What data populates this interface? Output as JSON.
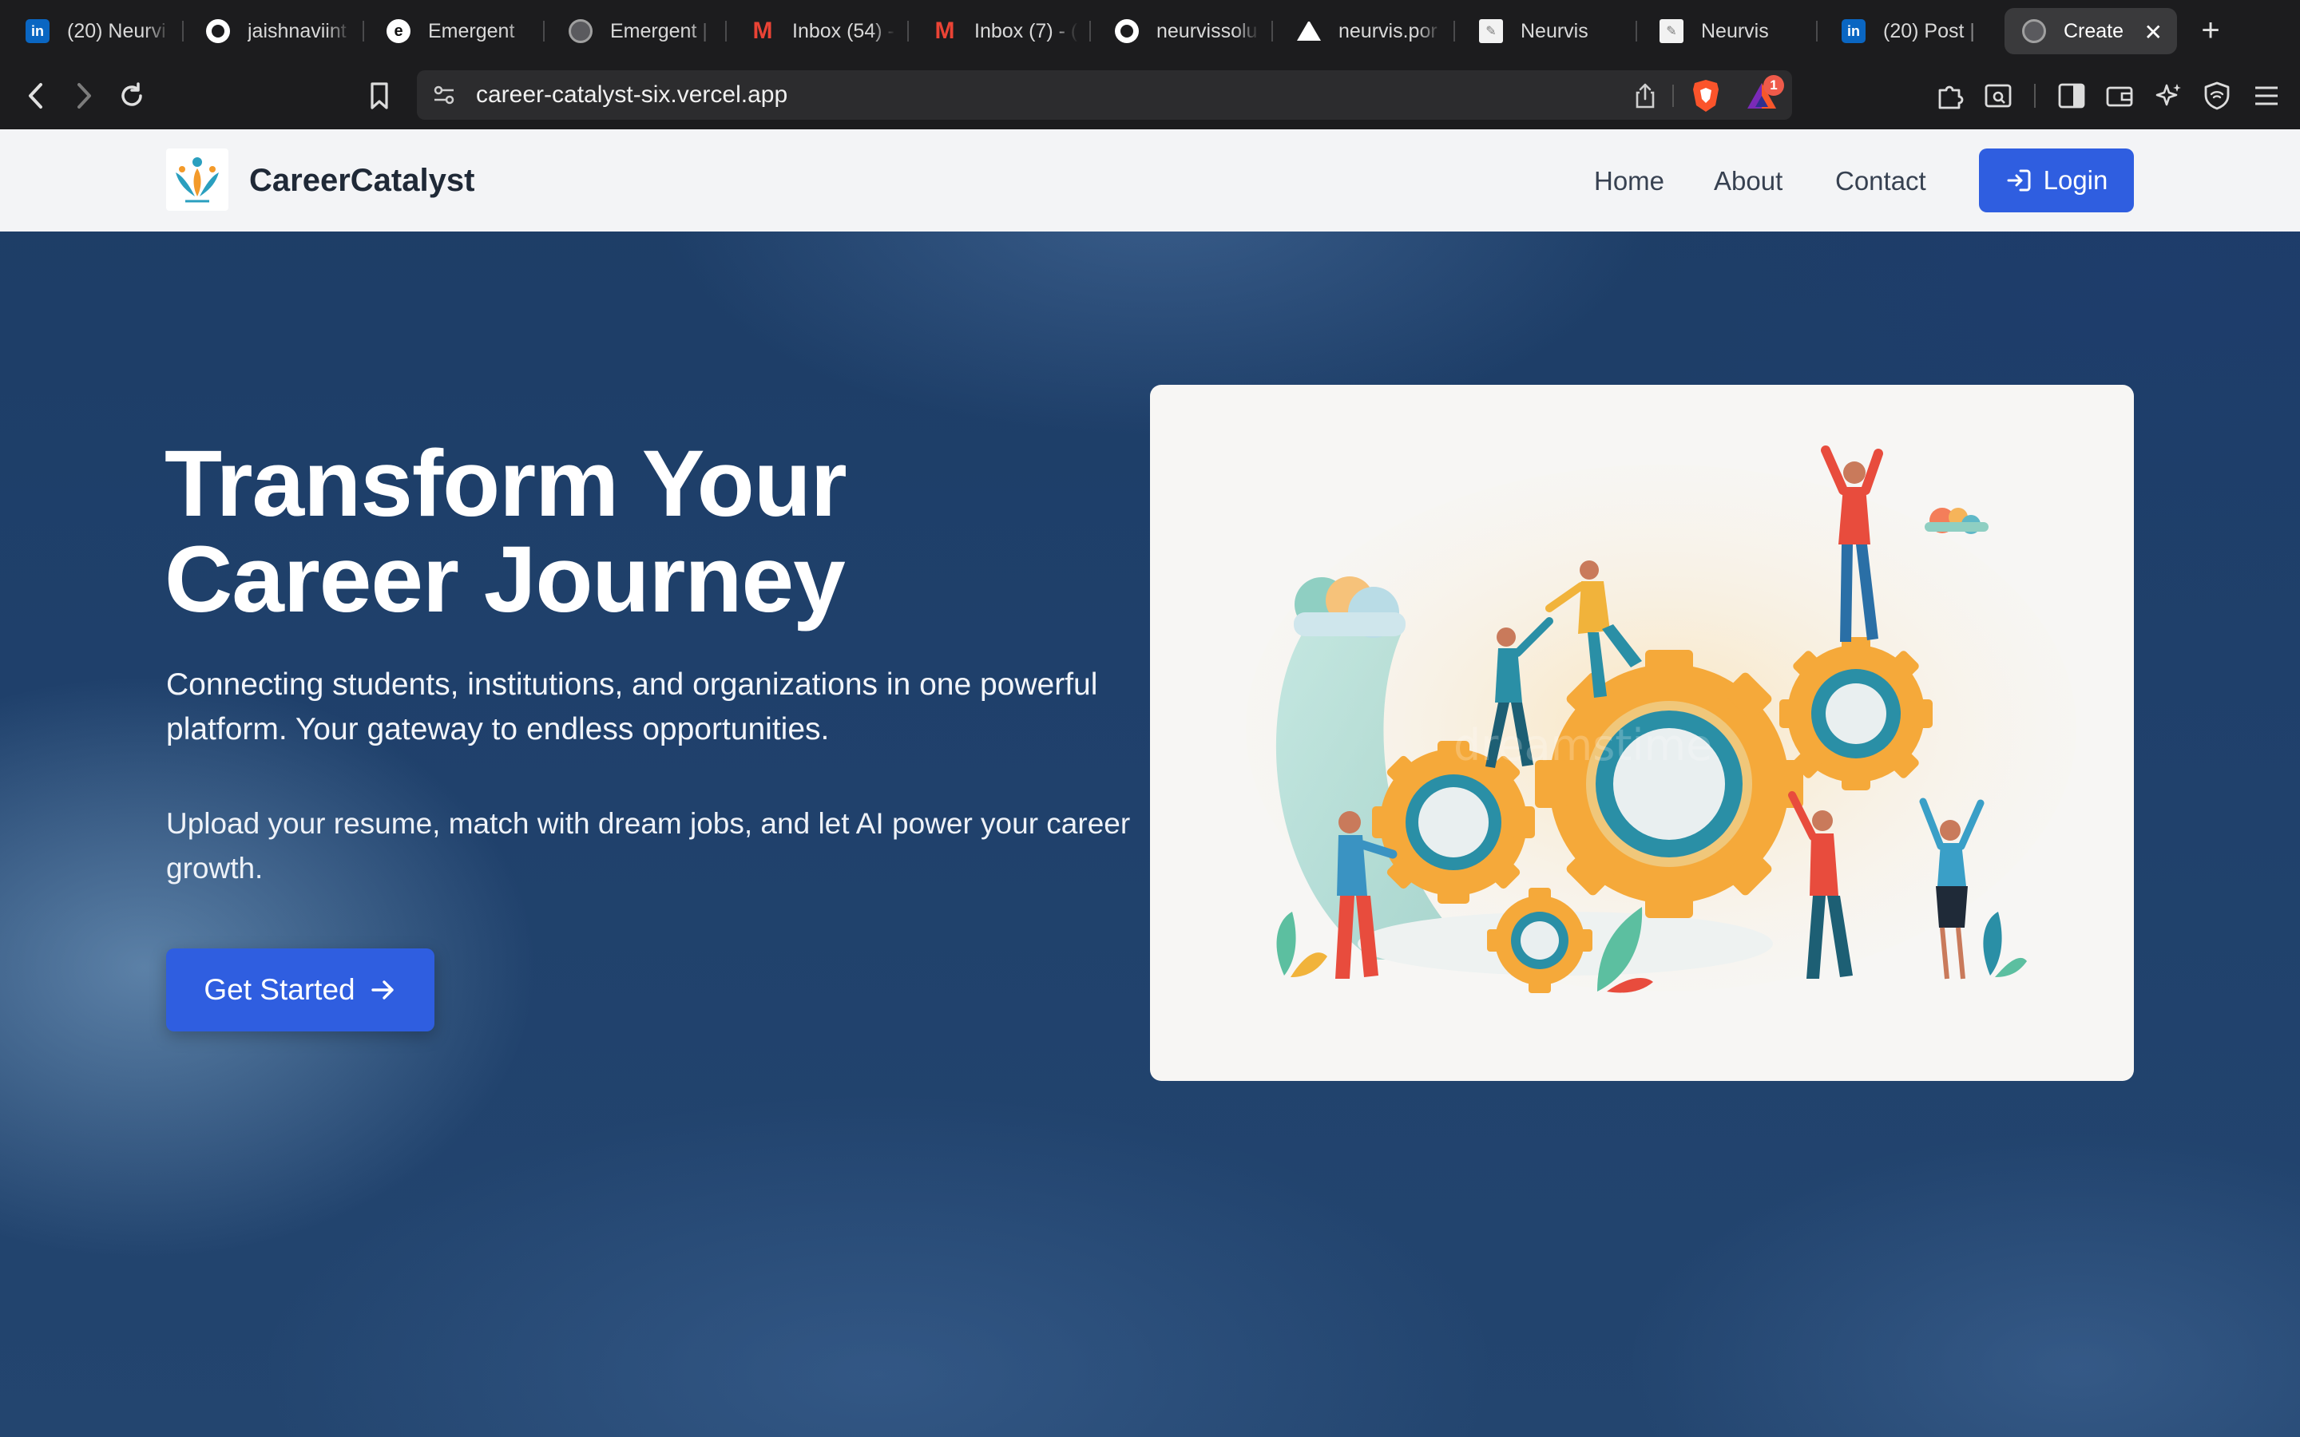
{
  "browser": {
    "tabs": [
      {
        "title": "(20) Neurvi",
        "icon": "linkedin-icon"
      },
      {
        "title": "jaishnaviint",
        "icon": "github-icon"
      },
      {
        "title": "Emergent",
        "icon": "emergent-icon"
      },
      {
        "title": "Emergent |",
        "icon": "globe-icon"
      },
      {
        "title": "Inbox (54) -",
        "icon": "gmail-icon"
      },
      {
        "title": "Inbox (7) - (",
        "icon": "gmail-icon"
      },
      {
        "title": "neurvissolu",
        "icon": "github-icon"
      },
      {
        "title": "neurvis.por",
        "icon": "vercel-icon"
      },
      {
        "title": "Neurvis",
        "icon": "neurvis-icon"
      },
      {
        "title": "Neurvis",
        "icon": "neurvis-icon"
      },
      {
        "title": "(20) Post |",
        "icon": "linkedin-icon"
      },
      {
        "title": "Create",
        "icon": "globe-icon",
        "active": true
      }
    ],
    "close_glyph": "✕",
    "new_tab_glyph": "+",
    "url": "career-catalyst-six.vercel.app",
    "rewards_badge": "1",
    "favicon_text": {
      "linkedin": "in",
      "emergent": "e",
      "gmail": "M"
    }
  },
  "site": {
    "brand": "CareerCatalyst",
    "nav": {
      "home": "Home",
      "about": "About",
      "contact": "Contact",
      "login": "Login"
    },
    "hero": {
      "title_line1": "Transform Your",
      "title_line2": "Career Journey",
      "subtitle": "Connecting students, institutions, and organizations in one powerful platform. Your gateway to endless opportunities.",
      "subtitle2": "Upload your resume, match with dream jobs, and let AI power your career growth.",
      "cta": "Get Started"
    },
    "illustration": {
      "watermark": "dreamstime"
    }
  },
  "colors": {
    "accent": "#2f5ee0",
    "navbar_bg": "#f3f4f6",
    "hero_bg": "#1f406b",
    "browser_chrome": "#1c1c1e",
    "gear_orange": "#f5a93a",
    "gear_teal": "#2a8fa6"
  }
}
